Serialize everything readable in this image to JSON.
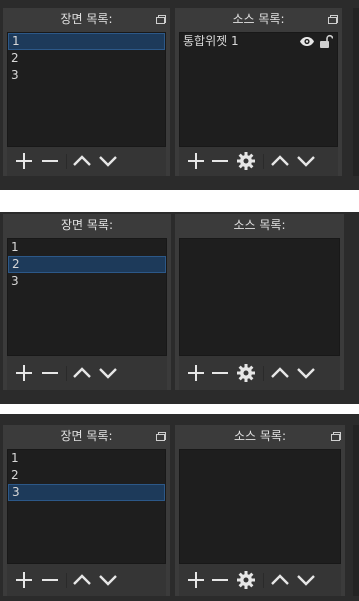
{
  "snapshots": [
    {
      "scenes_title": "장면 목록:",
      "sources_title": "소스 목록:",
      "scenes": [
        {
          "label": "1",
          "selected": true
        },
        {
          "label": "2",
          "selected": false
        },
        {
          "label": "3",
          "selected": false
        }
      ],
      "sources": [
        {
          "label": "통합위젯 1",
          "visible_icon": "eye-icon",
          "lock_icon": "unlocked-padlock-icon"
        }
      ]
    },
    {
      "scenes_title": "장면 목록:",
      "sources_title": "소스 목록:",
      "scenes": [
        {
          "label": "1",
          "selected": false
        },
        {
          "label": "2",
          "selected": true
        },
        {
          "label": "3",
          "selected": false
        }
      ],
      "sources": []
    },
    {
      "scenes_title": "장면 목록:",
      "sources_title": "소스 목록:",
      "scenes": [
        {
          "label": "1",
          "selected": false
        },
        {
          "label": "2",
          "selected": false
        },
        {
          "label": "3",
          "selected": true
        }
      ],
      "sources": []
    }
  ],
  "colors": {
    "panel": "#3b3b3b",
    "list_bg": "#1e1e1e",
    "selection": "#1d3a5a",
    "selection_border": "#2c5888",
    "text": "#d8d8d8"
  }
}
